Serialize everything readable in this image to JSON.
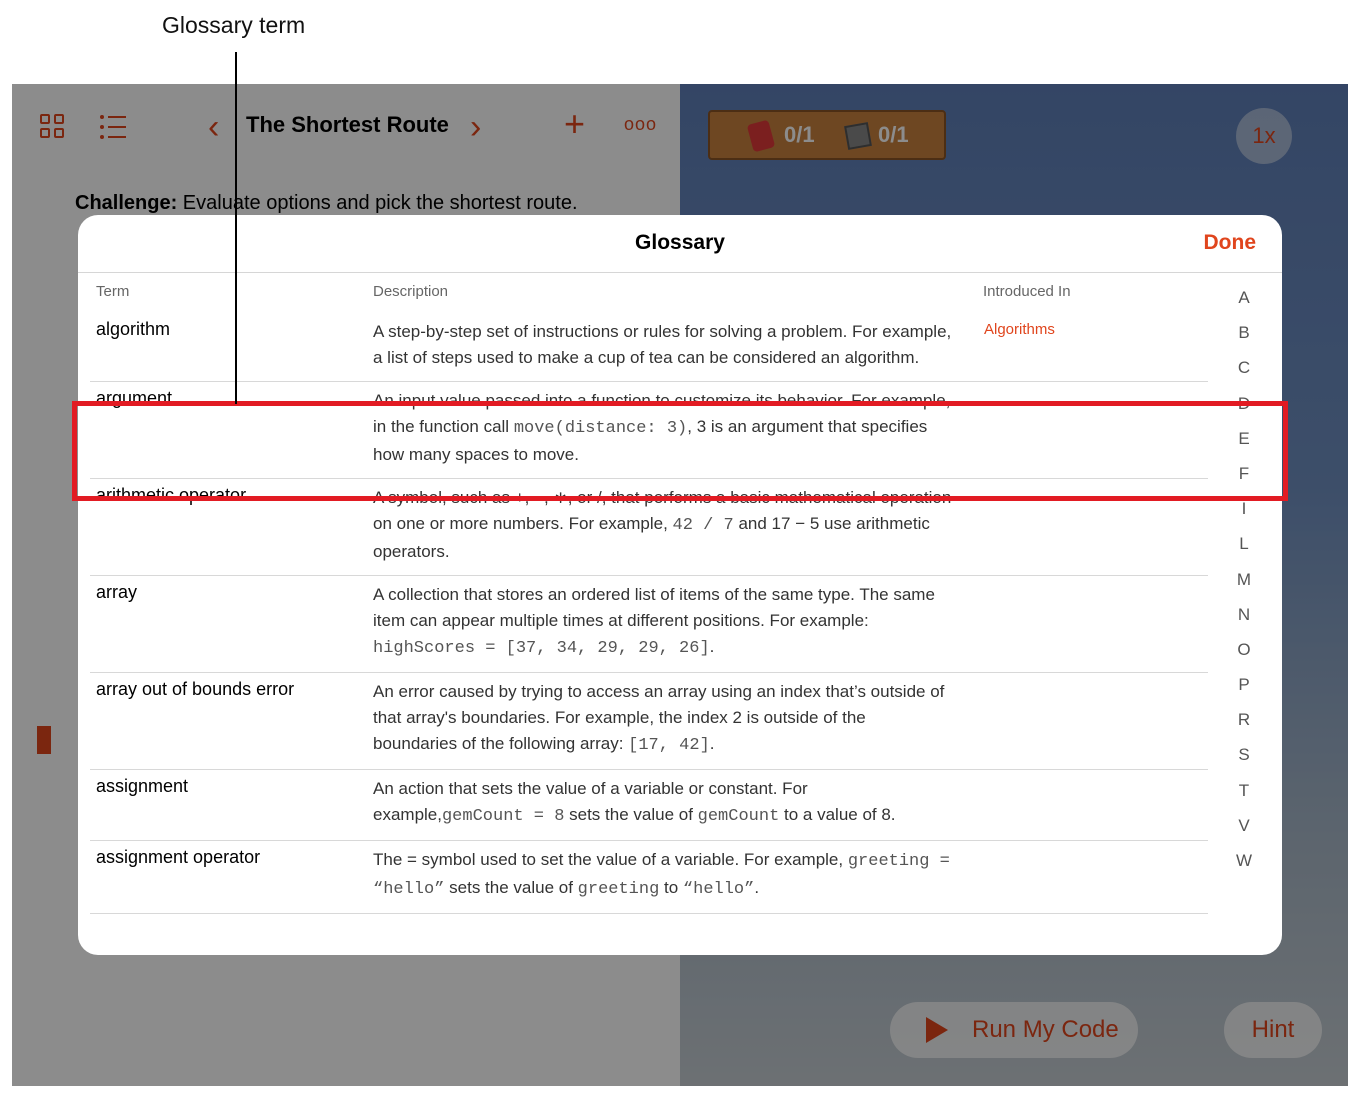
{
  "callout": {
    "label": "Glossary term"
  },
  "toolbar": {
    "title": "The Shortest Route",
    "prev_icon": "‹",
    "next_icon": "›",
    "add_icon": "+",
    "more_icon": "ooo"
  },
  "lesson": {
    "challenge_label": "Challenge:",
    "challenge_text": " Evaluate options and pick the shortest route."
  },
  "live_view": {
    "gems": "0/1",
    "switches": "0/1",
    "speed": "1x",
    "run_button": "Run My Code",
    "hint_button": "Hint"
  },
  "glossary": {
    "title": "Glossary",
    "done": "Done",
    "columns": {
      "term": "Term",
      "description": "Description",
      "introduced": "Introduced In"
    },
    "index_letters": [
      "A",
      "B",
      "C",
      "D",
      "E",
      "F",
      "I",
      "L",
      "M",
      "N",
      "O",
      "P",
      "R",
      "S",
      "T",
      "V",
      "W"
    ],
    "rows": [
      {
        "term": "algorithm",
        "introduced": "Algorithms",
        "description": [
          {
            "t": "A step-by-step set of instructions or rules for solving a problem. For example, a list of steps used to make a cup of tea can be considered an algorithm."
          }
        ]
      },
      {
        "term": "argument",
        "introduced": "",
        "description": [
          {
            "t": "An input value passed into a function to customize its behavior. For example, in the function call "
          },
          {
            "c": "move(distance: 3)"
          },
          {
            "t": ", 3 is an argument that specifies how many spaces to move."
          }
        ]
      },
      {
        "term": "arithmetic operator",
        "introduced": "",
        "description": [
          {
            "t": "A symbol, such as +, −, ∗, or /, that performs a basic mathematical operation on one or more numbers. For example, "
          },
          {
            "c": "42 / 7"
          },
          {
            "t": " and 17 − 5 use arithmetic operators."
          }
        ]
      },
      {
        "term": "array",
        "introduced": "",
        "description": [
          {
            "t": "A collection that stores an ordered list of items of the same type. The same item can appear multiple times at different positions. For example: "
          },
          {
            "c": "highScores = [37, 34, 29, 29, 26]"
          },
          {
            "t": "."
          }
        ]
      },
      {
        "term": "array out of bounds error",
        "introduced": "",
        "description": [
          {
            "t": "An error caused by trying to access an array using an index that’s outside of that array's boundaries. For example, the index 2 is outside of the boundaries of the following array: "
          },
          {
            "c": "[17, 42]"
          },
          {
            "t": "."
          }
        ]
      },
      {
        "term": "assignment",
        "introduced": "",
        "description": [
          {
            "t": "An action that sets the value of a variable or constant. For example,"
          },
          {
            "c": "gemCount = 8"
          },
          {
            "t": " sets the value of "
          },
          {
            "c": "gemCount"
          },
          {
            "t": " to a value of 8."
          }
        ]
      },
      {
        "term": "assignment operator",
        "introduced": "",
        "description": [
          {
            "t": "The = symbol used to set the value of a variable. For example, "
          },
          {
            "c": "greeting = “hello”"
          },
          {
            "t": " sets the value of "
          },
          {
            "c": "greeting"
          },
          {
            "t": " to "
          },
          {
            "c": "“hello”"
          },
          {
            "t": "."
          }
        ]
      }
    ]
  }
}
